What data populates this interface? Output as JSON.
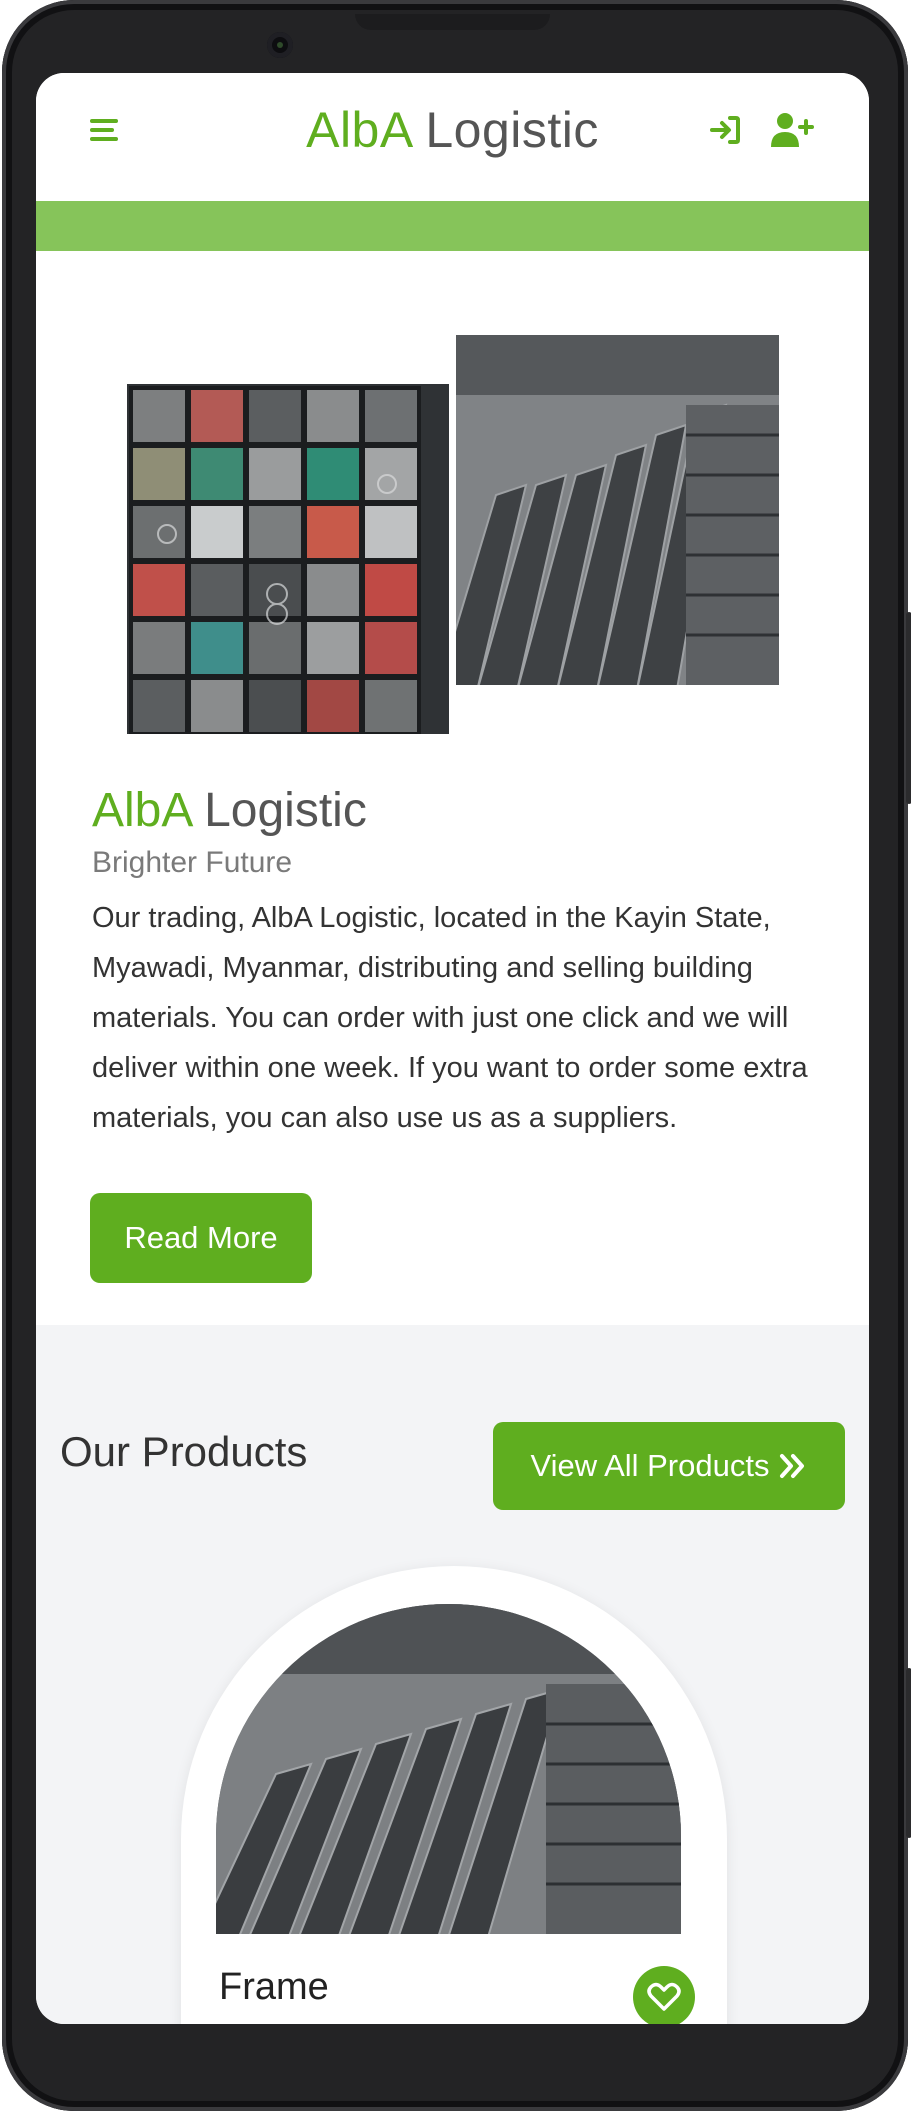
{
  "app": {
    "brand_part1": "AlbA",
    "brand_part2": "Logistic"
  },
  "header": {
    "menu_icon": "hamburger-icon",
    "login_icon": "login-icon",
    "register_icon": "add-user-icon"
  },
  "about": {
    "title_part1": "AlbA",
    "title_part2": "Logistic",
    "subtitle": "Brighter Future",
    "text": "Our trading, AlbA Logistic, located in the Kayin State, Myawadi, Myanmar, distributing and selling building materials. You can order with just one click and we will deliver within one week. If you want to order some extra materials, you can also use us as a suppliers.",
    "read_more_label": "Read More"
  },
  "products": {
    "title": "Our Products",
    "view_all_label": "View All Products",
    "view_all_icon": "double-chevron-right-icon",
    "items": [
      {
        "name": "Frame",
        "action_icon": "heart-icon"
      }
    ]
  },
  "colors": {
    "accent": "#5fae1f",
    "accent_light": "#86c45a",
    "text_dark": "#333333",
    "text_muted": "#7a7a7a"
  }
}
